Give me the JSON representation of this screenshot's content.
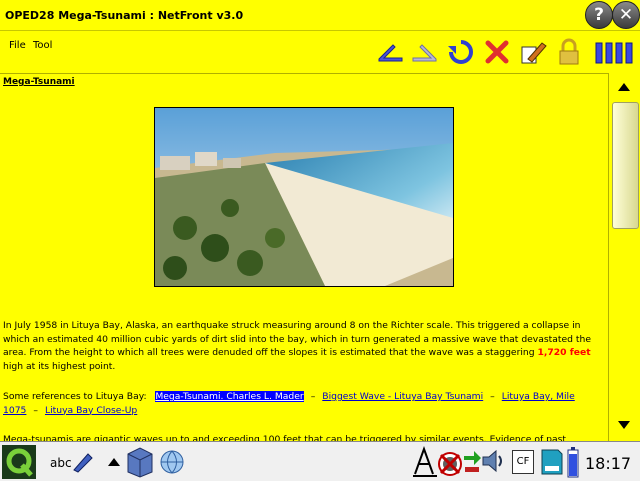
{
  "window": {
    "title": "OPED28 Mega-Tsunami : NetFront v3.0",
    "help_label": "?",
    "close_label": "✕"
  },
  "menubar": {
    "file": "File",
    "tool": "Tool"
  },
  "toolbar_icons": [
    "back-icon",
    "forward-icon",
    "refresh-icon",
    "stop-icon",
    "edit-icon",
    "lock-icon",
    "columns-icon"
  ],
  "page": {
    "heading": "Mega-Tsunami",
    "paragraph1": "In July 1958 in Lituya Bay, Alaska, an earthquake struck measuring around 8 on the Richter scale. This triggered a collapse in which an estimated 40 million cubic yards of dirt slid into the bay, which in turn generated a massive wave that devastated the area. From the height to which all trees were denuded off the slopes it is estimated that the wave was a staggering ",
    "highlight": "1,720 feet",
    "paragraph1_end": " high at its highest point.",
    "refs_label": "Some references to Lituya Bay:",
    "links": [
      "Mega-Tsunami. Charles L. Mader",
      "Biggest Wave - Lituya Bay Tsunami",
      "Lituya Bay, Mile 1075",
      "Lituya Bay Close-Up"
    ],
    "link_separator": "–",
    "paragraph2": "Mega-tsunamis are gigantic waves up to and exceeding 100 feet that can be triggered by similar events. Evidence of past"
  },
  "taskbar": {
    "clock": "18:17",
    "input_label": "abc",
    "cf_label": "CF"
  },
  "colors": {
    "background": "#ffff00",
    "link": "#0000cc",
    "selected_link_bg": "#0000ff",
    "highlight": "#ff0000"
  }
}
